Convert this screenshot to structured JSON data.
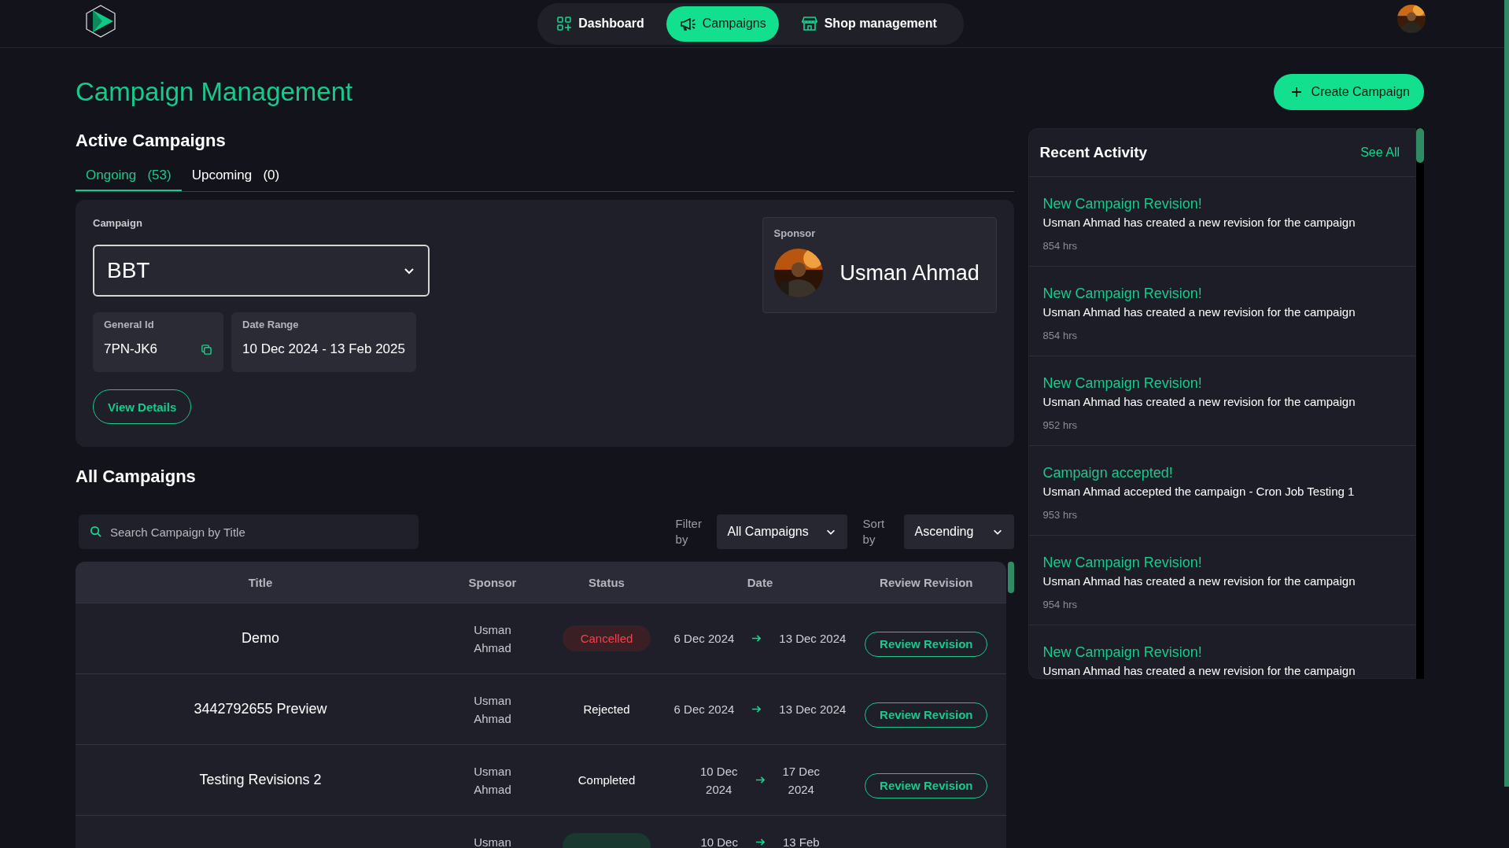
{
  "nav": {
    "tabs": [
      {
        "label": "Dashboard",
        "selected": false
      },
      {
        "label": "Campaigns",
        "selected": true
      },
      {
        "label": "Shop management",
        "selected": false
      }
    ]
  },
  "page_title": "Campaign Management",
  "create_button": "Create Campaign",
  "active_campaigns": {
    "heading": "Active Campaigns",
    "tabs": [
      {
        "label": "Ongoing",
        "count": "(53)",
        "selected": true
      },
      {
        "label": "Upcoming",
        "count": "(0)",
        "selected": false
      }
    ],
    "campaign_label": "Campaign",
    "campaign_value": "BBT",
    "general_id_label": "General Id",
    "general_id": "7PN-JK6",
    "date_range_label": "Date Range",
    "date_range": "10 Dec 2024 - 13 Feb 2025",
    "view_details": "View Details",
    "sponsor_label": "Sponsor",
    "sponsor_name": "Usman Ahmad"
  },
  "all_campaigns": {
    "heading": "All Campaigns",
    "search": {
      "placeholder": "Search Campaign by Title"
    },
    "filter_label": "Filter by",
    "filter_value": "All Campaigns",
    "sort_label": "Sort by",
    "sort_value": "Ascending",
    "table": {
      "columns": [
        "Title",
        "Sponsor",
        "Status",
        "Date",
        "Review Revision"
      ],
      "rows": [
        {
          "title": "Demo",
          "sponsor": "Usman Ahmad",
          "status": {
            "kind": "cancelled",
            "label": "Cancelled"
          },
          "start": "6 Dec 2024",
          "end": "13 Dec 2024",
          "action": "Review Revision"
        },
        {
          "title": "3442792655 Preview",
          "sponsor": "Usman Ahmad",
          "status": {
            "kind": "plain",
            "label": "Rejected"
          },
          "start": "6 Dec 2024",
          "end": "13 Dec 2024",
          "action": "Review Revision"
        },
        {
          "title": "Testing Revisions 2",
          "sponsor": "Usman Ahmad",
          "status": {
            "kind": "plain",
            "label": "Completed"
          },
          "start": "10 Dec\n2024",
          "end": "17 Dec\n2024",
          "action": "Review Revision"
        },
        {
          "sponsor": "Usman",
          "status": {
            "kind": "success"
          },
          "start": "10 Dec",
          "end": "13 Feb"
        }
      ]
    }
  },
  "recent_activity": {
    "heading": "Recent Activity",
    "see_all": "See All",
    "items": [
      {
        "title": "New Campaign Revision!",
        "text": "Usman Ahmad has created a new revision for the campaign",
        "time": "854 hrs"
      },
      {
        "title": "New Campaign Revision!",
        "text": "Usman Ahmad has created a new revision for the campaign",
        "time": "854 hrs"
      },
      {
        "title": "New Campaign Revision!",
        "text": "Usman Ahmad has created a new revision for the campaign",
        "time": "952 hrs"
      },
      {
        "title": "Campaign accepted!",
        "text": "Usman Ahmad accepted the campaign - Cron Job Testing 1",
        "time": "953 hrs"
      },
      {
        "title": "New Campaign Revision!",
        "text": "Usman Ahmad has created a new revision for the campaign",
        "time": "954 hrs"
      },
      {
        "title": "New Campaign Revision!",
        "text": "Usman Ahmad has created a new revision for the campaign"
      }
    ]
  }
}
